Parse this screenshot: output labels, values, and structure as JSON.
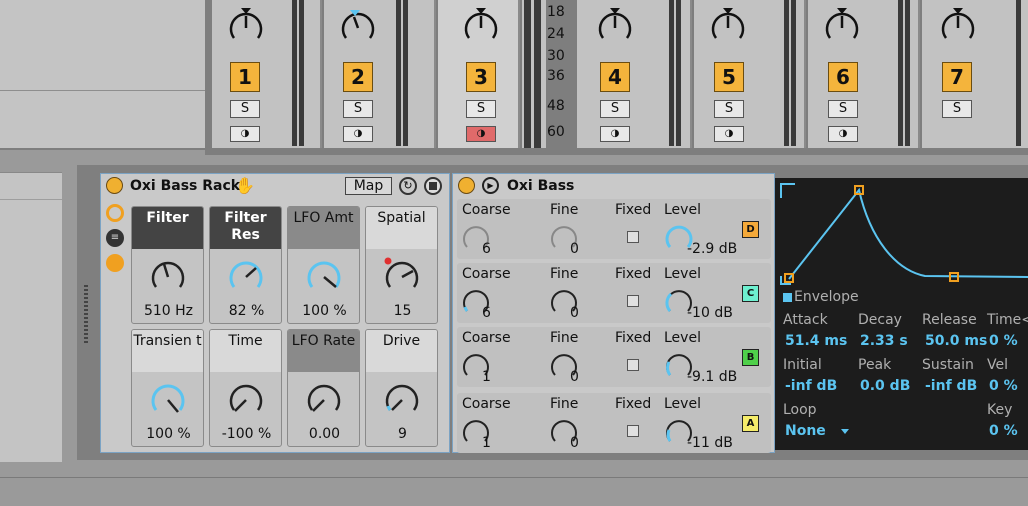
{
  "mixer": {
    "tracks": [
      {
        "number": "1",
        "solo": "S",
        "mon": "◑"
      },
      {
        "number": "2",
        "solo": "S",
        "mon": "◑"
      },
      {
        "number": "3",
        "solo": "S",
        "mon": "◑"
      },
      {
        "number": "4",
        "solo": "S",
        "mon": "◑"
      },
      {
        "number": "5",
        "solo": "S",
        "mon": "◑"
      },
      {
        "number": "6",
        "solo": "S",
        "mon": "◑"
      },
      {
        "number": "7",
        "solo": "S",
        "mon": "◑"
      }
    ],
    "scale": [
      "18",
      "24",
      "30",
      "36",
      "48",
      "60"
    ]
  },
  "rack": {
    "title": "Oxi Bass Rack",
    "map_label": "Map",
    "macros": [
      {
        "name": "Filter",
        "value": "510 Hz",
        "level": 0.42
      },
      {
        "name": "Filter Res",
        "value": "82 %",
        "level": 0.82
      },
      {
        "name": "LFO Amt",
        "value": "100 %",
        "level": 1.0
      },
      {
        "name": "Spatial",
        "value": "15",
        "level": 0.6
      },
      {
        "name": "Transien t",
        "value": "100 %",
        "level": 1.0
      },
      {
        "name": "Time",
        "value": "-100 %",
        "level": 0.5
      },
      {
        "name": "LFO Rate",
        "value": "0.00",
        "level": 0.0
      },
      {
        "name": "Drive",
        "value": "9",
        "level": 0.09
      }
    ]
  },
  "synth": {
    "title": "Oxi Bass",
    "col_labels": {
      "coarse": "Coarse",
      "fine": "Fine",
      "fixed": "Fixed",
      "level": "Level"
    },
    "operators": [
      {
        "coarse": "6",
        "fine": "0",
        "level": "-2.9 dB",
        "button": "D",
        "color": "#f4a93a"
      },
      {
        "coarse": "6",
        "fine": "0",
        "level": "-10 dB",
        "button": "C",
        "color": "#6ef0d0"
      },
      {
        "coarse": "1",
        "fine": "0",
        "level": "-9.1 dB",
        "button": "B",
        "color": "#4fd04a"
      },
      {
        "coarse": "1",
        "fine": "0",
        "level": "-11 dB",
        "button": "A",
        "color": "#f5ec6a"
      }
    ]
  },
  "envelope": {
    "title": "Envelope",
    "attack_label": "Attack",
    "attack": "51.4 ms",
    "decay_label": "Decay",
    "decay": "2.33 s",
    "release_label": "Release",
    "release": "50.0 ms",
    "time_label": "Time<",
    "time": "0 %",
    "initial_label": "Initial",
    "initial": "-inf dB",
    "peak_label": "Peak",
    "peak": "0.0 dB",
    "sustain_label": "Sustain",
    "sustain": "-inf dB",
    "vel_label": "Vel",
    "vel": "0 %",
    "loop_label": "Loop",
    "loop": "None",
    "key_label": "Key",
    "key": "0 %",
    "accent": "#5bc4f0"
  }
}
